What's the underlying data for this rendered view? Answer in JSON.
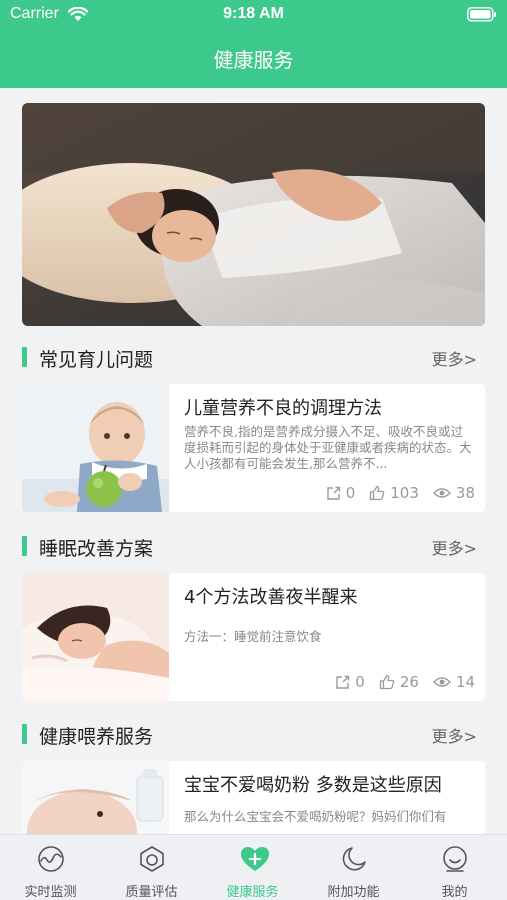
{
  "status_bar": {
    "carrier": "Carrier",
    "time": "9:18 AM"
  },
  "nav": {
    "title": "健康服务"
  },
  "sections": [
    {
      "title": "常见育儿问题",
      "more": "更多>",
      "card": {
        "title": "儿童营养不良的调理方法",
        "desc": "营养不良,指的是营养成分摄入不足、吸收不良或过度损耗而引起的身体处于亚健康或者疾病的状态。大人小孩都有可能会发生,那么营养不...",
        "shares": "0",
        "likes": "103",
        "views": "38"
      }
    },
    {
      "title": "睡眠改善方案",
      "more": "更多>",
      "card": {
        "title": "4个方法改善夜半醒来",
        "desc": "方法一：睡觉前注意饮食",
        "shares": "0",
        "likes": "26",
        "views": "14"
      }
    },
    {
      "title": "健康喂养服务",
      "more": "更多>",
      "card": {
        "title": "宝宝不爱喝奶粉 多数是这些原因",
        "desc": "那么为什么宝宝会不爱喝奶粉呢？妈妈们你们有",
        "shares": "",
        "likes": "",
        "views": ""
      }
    }
  ],
  "tabs": [
    {
      "label": "实时监测",
      "icon": "monitor-wave-icon"
    },
    {
      "label": "质量评估",
      "icon": "hexagon-circle-icon"
    },
    {
      "label": "健康服务",
      "icon": "heart-plus-icon"
    },
    {
      "label": "附加功能",
      "icon": "moon-icon"
    },
    {
      "label": "我的",
      "icon": "smiley-profile-icon"
    }
  ],
  "colors": {
    "accent": "#3ec98c",
    "inactive_tab": "#555555"
  }
}
